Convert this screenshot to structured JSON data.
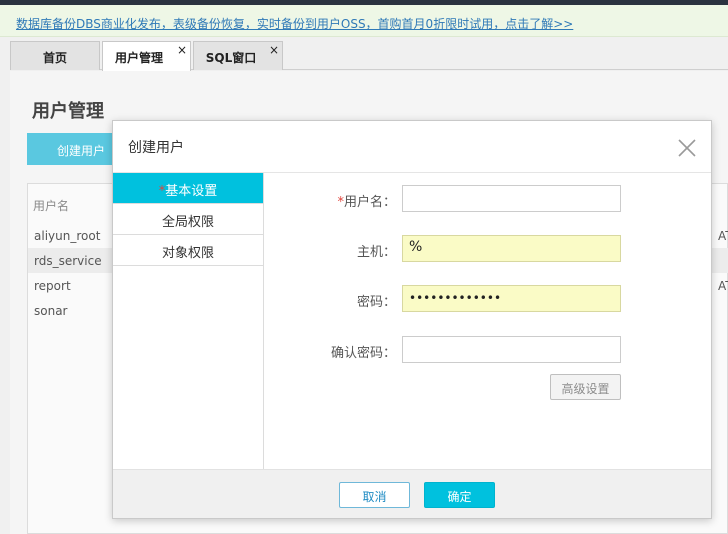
{
  "notice": {
    "text": "数据库备份DBS商业化发布，表级备份恢复，实时备份到用户OSS，首购首月0折限时试用，点击了解>>"
  },
  "tabs": [
    {
      "label": "首页",
      "closable": false,
      "active": false
    },
    {
      "label": "用户管理",
      "close": "×",
      "active": true
    },
    {
      "label": "SQL窗口",
      "close": "×",
      "active": false
    }
  ],
  "page": {
    "title": "用户管理",
    "create_button": "创建用户",
    "table": {
      "header_username": "用户名",
      "rows": [
        {
          "username": "aliyun_root",
          "tail": "AT"
        },
        {
          "username": "rds_service",
          "tail": ""
        },
        {
          "username": "report",
          "tail": "AT"
        },
        {
          "username": "sonar",
          "tail": ""
        }
      ]
    }
  },
  "modal": {
    "title": "创建用户",
    "close_icon": "close-icon",
    "nav": [
      {
        "label": "基本设置",
        "required_mark": "*",
        "active": true
      },
      {
        "label": "全局权限",
        "active": false
      },
      {
        "label": "对象权限",
        "active": false
      }
    ],
    "form": {
      "username": {
        "required_mark": "*",
        "label": "用户名：",
        "value": ""
      },
      "host": {
        "label": "主机：",
        "value": "%"
      },
      "password": {
        "label": "密码：",
        "value": "•••••••••••••"
      },
      "confirm": {
        "label": "确认密码：",
        "value": ""
      },
      "advanced_button": "高级设置"
    },
    "footer": {
      "cancel": "取消",
      "ok": "确定"
    }
  },
  "colors": {
    "accent": "#00c1de",
    "create_button": "#5ac8e0",
    "autofill": "#fafbc6",
    "required": "#e0443c",
    "link": "#2f79b7"
  }
}
